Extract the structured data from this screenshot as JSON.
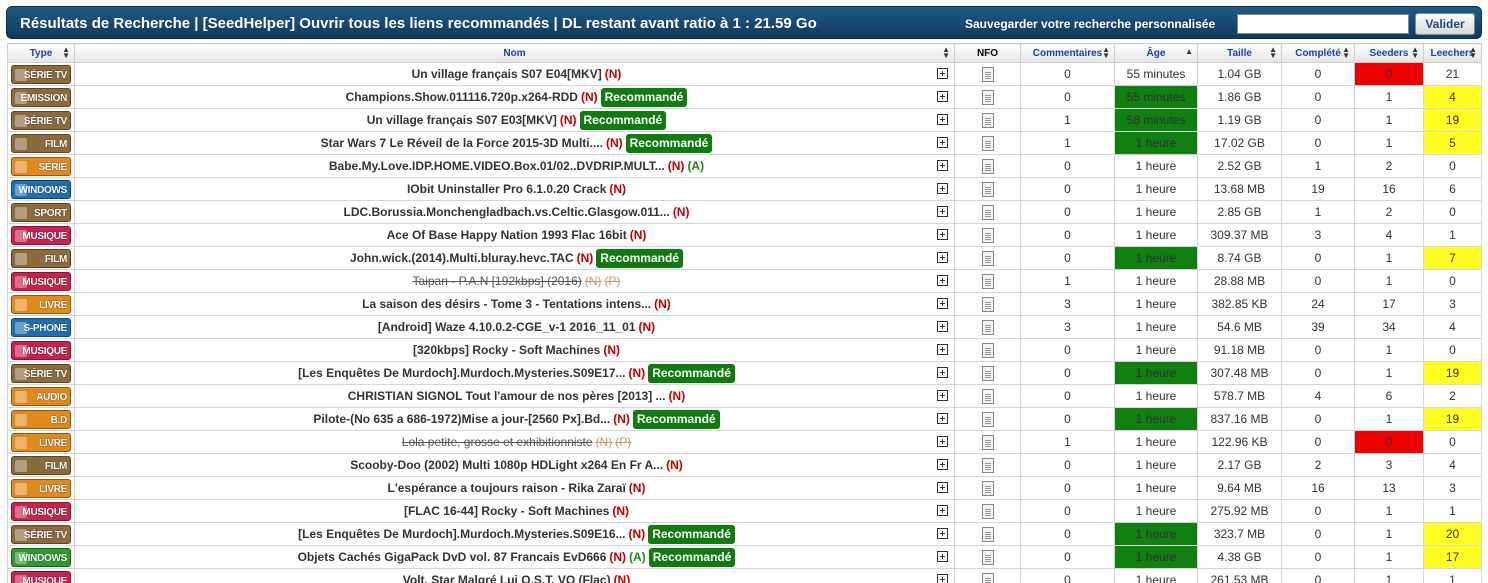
{
  "header": {
    "title": "Résultats de Recherche | [SeedHelper] Ouvrir tous les liens recommandés | DL restant avant ratio à 1 : 21.59 Go",
    "save_label": "Sauvegarder votre recherche personnalisée",
    "save_input_value": "",
    "validate_label": "Valider"
  },
  "columns": {
    "type": "Type",
    "name": "Nom",
    "nfo": "NFO",
    "comments": "Commentaires",
    "age": "Âge",
    "size": "Taille",
    "completed": "Complété",
    "seeders": "Seeders",
    "leechers": "Leechers"
  },
  "colors": {
    "header_bg": "#1a4c74",
    "recommended_bg": "#107c10",
    "age_highlight": "#108010",
    "seed_zero": "#f00000",
    "leech_high": "#ffff22"
  },
  "rows": [
    {
      "cat": "SÉRIE TV",
      "cat_color": "#8c6a3c",
      "name": "Un village français S07 E04[MKV]",
      "n": "(N)",
      "a": "",
      "reco": "",
      "strike": false,
      "comments": "0",
      "age": "55 minutes",
      "age_green": false,
      "size": "1.04 GB",
      "completed": "0",
      "seeders": "0",
      "seed_red": true,
      "leechers": "21",
      "leech_yellow": false
    },
    {
      "cat": "EMISSION",
      "cat_color": "#8c6a3c",
      "name": "Champions.Show.011116.720p.x264-RDD",
      "n": "(N)",
      "a": "",
      "reco": "Recommandé",
      "strike": false,
      "comments": "0",
      "age": "55 minutes",
      "age_green": true,
      "size": "1.86 GB",
      "completed": "0",
      "seeders": "1",
      "seed_red": false,
      "leechers": "4",
      "leech_yellow": true
    },
    {
      "cat": "SÉRIE TV",
      "cat_color": "#8c6a3c",
      "name": "Un village français S07 E03[MKV]",
      "n": "(N)",
      "a": "",
      "reco": "Recommandé",
      "strike": false,
      "comments": "1",
      "age": "58 minutes",
      "age_green": true,
      "size": "1.19 GB",
      "completed": "0",
      "seeders": "1",
      "seed_red": false,
      "leechers": "19",
      "leech_yellow": true
    },
    {
      "cat": "FILM",
      "cat_color": "#8c6a3c",
      "name": "Star Wars 7 Le Réveil de la Force 2015-3D Multi....",
      "n": "(N)",
      "a": "",
      "reco": "Recommandé",
      "strike": false,
      "comments": "1",
      "age": "1 heure",
      "age_green": true,
      "size": "17.02 GB",
      "completed": "0",
      "seeders": "1",
      "seed_red": false,
      "leechers": "5",
      "leech_yellow": true
    },
    {
      "cat": "SÉRIE",
      "cat_color": "#e08a1e",
      "name": "Babe.My.Love.IDP.HOME.VIDEO.Box.01/02..DVDRIP.MULT...",
      "n": "(N)",
      "a": "(A)",
      "reco": "",
      "strike": false,
      "comments": "0",
      "age": "1 heure",
      "age_green": false,
      "size": "2.52 GB",
      "completed": "1",
      "seeders": "2",
      "seed_red": false,
      "leechers": "0",
      "leech_yellow": false
    },
    {
      "cat": "WINDOWS",
      "cat_color": "#1f6fb0",
      "name": "IObit Uninstaller Pro 6.1.0.20 Crack",
      "n": "(N)",
      "a": "",
      "reco": "",
      "strike": false,
      "comments": "0",
      "age": "1 heure",
      "age_green": false,
      "size": "13.68 MB",
      "completed": "19",
      "seeders": "16",
      "seed_red": false,
      "leechers": "6",
      "leech_yellow": false
    },
    {
      "cat": "SPORT",
      "cat_color": "#8c6a3c",
      "name": "LDC.Borussia.Monchengladbach.vs.Celtic.Glasgow.011...",
      "n": "(N)",
      "a": "",
      "reco": "",
      "strike": false,
      "comments": "0",
      "age": "1 heure",
      "age_green": false,
      "size": "2.85 GB",
      "completed": "1",
      "seeders": "2",
      "seed_red": false,
      "leechers": "0",
      "leech_yellow": false
    },
    {
      "cat": "MUSIQUE",
      "cat_color": "#c8234e",
      "name": "Ace Of Base Happy Nation 1993 Flac 16bit",
      "n": "(N)",
      "a": "",
      "reco": "",
      "strike": false,
      "comments": "0",
      "age": "1 heure",
      "age_green": false,
      "size": "309.37 MB",
      "completed": "3",
      "seeders": "4",
      "seed_red": false,
      "leechers": "1",
      "leech_yellow": false
    },
    {
      "cat": "FILM",
      "cat_color": "#8c6a3c",
      "name": "John.wick.(2014).Multi.bluray.hevc.TAC",
      "n": "(N)",
      "a": "",
      "reco": "Recommandé",
      "strike": false,
      "comments": "0",
      "age": "1 heure",
      "age_green": true,
      "size": "8.74 GB",
      "completed": "0",
      "seeders": "1",
      "seed_red": false,
      "leechers": "7",
      "leech_yellow": true
    },
    {
      "cat": "MUSIQUE",
      "cat_color": "#c8234e",
      "name": "Taipan - P.A.N [192kbps] (2016)",
      "n": "(N)",
      "a": "(P)",
      "reco": "",
      "strike": true,
      "comments": "1",
      "age": "1 heure",
      "age_green": false,
      "size": "28.88 MB",
      "completed": "0",
      "seeders": "1",
      "seed_red": false,
      "leechers": "0",
      "leech_yellow": false
    },
    {
      "cat": "LIVRE",
      "cat_color": "#e08a1e",
      "name": "La saison des désirs - Tome 3 - Tentations intens...",
      "n": "(N)",
      "a": "",
      "reco": "",
      "strike": false,
      "comments": "3",
      "age": "1 heure",
      "age_green": false,
      "size": "382.85 KB",
      "completed": "24",
      "seeders": "17",
      "seed_red": false,
      "leechers": "3",
      "leech_yellow": false
    },
    {
      "cat": "S-PHONE",
      "cat_color": "#1f6fb0",
      "name": "[Android] Waze 4.10.0.2-CGE_v-1 2016_11_01",
      "n": "(N)",
      "a": "",
      "reco": "",
      "strike": false,
      "comments": "3",
      "age": "1 heure",
      "age_green": false,
      "size": "54.6 MB",
      "completed": "39",
      "seeders": "34",
      "seed_red": false,
      "leechers": "4",
      "leech_yellow": false
    },
    {
      "cat": "MUSIQUE",
      "cat_color": "#c8234e",
      "name": "[320kbps] Rocky - Soft Machines",
      "n": "(N)",
      "a": "",
      "reco": "",
      "strike": false,
      "comments": "0",
      "age": "1 heure",
      "age_green": false,
      "size": "91.18 MB",
      "completed": "0",
      "seeders": "1",
      "seed_red": false,
      "leechers": "0",
      "leech_yellow": false
    },
    {
      "cat": "SÉRIE TV",
      "cat_color": "#8c6a3c",
      "name": "[Les Enquêtes De Murdoch].Murdoch.Mysteries.S09E17...",
      "n": "(N)",
      "a": "",
      "reco": "Recommandé",
      "strike": false,
      "comments": "0",
      "age": "1 heure",
      "age_green": true,
      "size": "307.48 MB",
      "completed": "0",
      "seeders": "1",
      "seed_red": false,
      "leechers": "19",
      "leech_yellow": true
    },
    {
      "cat": "AUDIO",
      "cat_color": "#e08a1e",
      "name": "CHRISTIAN SIGNOL Tout l'amour de nos pères [2013] ...",
      "n": "(N)",
      "a": "",
      "reco": "",
      "strike": false,
      "comments": "0",
      "age": "1 heure",
      "age_green": false,
      "size": "578.7 MB",
      "completed": "4",
      "seeders": "6",
      "seed_red": false,
      "leechers": "2",
      "leech_yellow": false
    },
    {
      "cat": "B.D",
      "cat_color": "#e08a1e",
      "name": "Pilote-(No 635 a 686-1972)Mise a jour-[2560 Px].Bd...",
      "n": "(N)",
      "a": "",
      "reco": "Recommandé",
      "strike": false,
      "comments": "0",
      "age": "1 heure",
      "age_green": true,
      "size": "837.16 MB",
      "completed": "0",
      "seeders": "1",
      "seed_red": false,
      "leechers": "19",
      "leech_yellow": true
    },
    {
      "cat": "LIVRE",
      "cat_color": "#e08a1e",
      "name": "Lola petite, grosse et exhibitionniste",
      "n": "(N)",
      "a": "(P)",
      "reco": "",
      "strike": true,
      "comments": "1",
      "age": "1 heure",
      "age_green": false,
      "size": "122.96 KB",
      "completed": "0",
      "seeders": "0",
      "seed_red": true,
      "leechers": "0",
      "leech_yellow": false
    },
    {
      "cat": "FILM",
      "cat_color": "#8c6a3c",
      "name": "Scooby-Doo (2002) Multi 1080p HDLight x264 En Fr A...",
      "n": "(N)",
      "a": "",
      "reco": "",
      "strike": false,
      "comments": "0",
      "age": "1 heure",
      "age_green": false,
      "size": "2.17 GB",
      "completed": "2",
      "seeders": "3",
      "seed_red": false,
      "leechers": "4",
      "leech_yellow": false
    },
    {
      "cat": "LIVRE",
      "cat_color": "#e08a1e",
      "name": "L'espérance a toujours raison - Rika Zaraï",
      "n": "(N)",
      "a": "",
      "reco": "",
      "strike": false,
      "comments": "0",
      "age": "1 heure",
      "age_green": false,
      "size": "9.64 MB",
      "completed": "16",
      "seeders": "13",
      "seed_red": false,
      "leechers": "3",
      "leech_yellow": false
    },
    {
      "cat": "MUSIQUE",
      "cat_color": "#c8234e",
      "name": "[FLAC 16-44] Rocky - Soft Machines",
      "n": "(N)",
      "a": "",
      "reco": "",
      "strike": false,
      "comments": "0",
      "age": "1 heure",
      "age_green": false,
      "size": "275.92 MB",
      "completed": "0",
      "seeders": "1",
      "seed_red": false,
      "leechers": "1",
      "leech_yellow": false
    },
    {
      "cat": "SÉRIE TV",
      "cat_color": "#8c6a3c",
      "name": "[Les Enquêtes De Murdoch].Murdoch.Mysteries.S09E16...",
      "n": "(N)",
      "a": "",
      "reco": "Recommandé",
      "strike": false,
      "comments": "0",
      "age": "1 heure",
      "age_green": true,
      "size": "323.7 MB",
      "completed": "0",
      "seeders": "1",
      "seed_red": false,
      "leechers": "20",
      "leech_yellow": true
    },
    {
      "cat": "WINDOWS",
      "cat_color": "#2e9a2e",
      "name": "Objets Cachés GigaPack DvD vol. 87 Francais EvD666",
      "n": "(N)",
      "a": "(A)",
      "reco": "Recommandé",
      "strike": false,
      "comments": "0",
      "age": "1 heure",
      "age_green": true,
      "size": "4.38 GB",
      "completed": "0",
      "seeders": "1",
      "seed_red": false,
      "leechers": "17",
      "leech_yellow": true
    },
    {
      "cat": "MUSIQUE",
      "cat_color": "#c8234e",
      "name": "Volt. Star Malgré Lui O.S.T. VO (Flac)",
      "n": "(N)",
      "a": "",
      "reco": "",
      "strike": false,
      "comments": "0",
      "age": "1 heure",
      "age_green": false,
      "size": "261.53 MB",
      "completed": "0",
      "seeders": "1",
      "seed_red": false,
      "leechers": "1",
      "leech_yellow": false
    }
  ]
}
